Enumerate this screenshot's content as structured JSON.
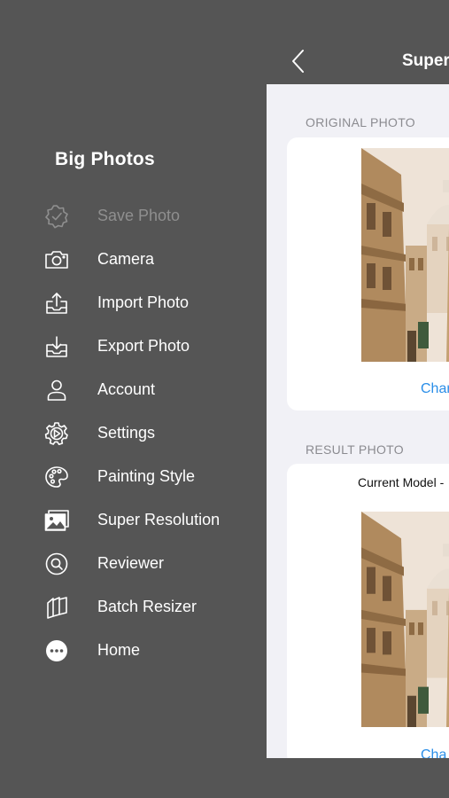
{
  "menu": {
    "title": "Big Photos",
    "items": [
      {
        "label": "Save Photo",
        "icon": "save-check-icon",
        "enabled": false
      },
      {
        "label": "Camera",
        "icon": "camera-icon",
        "enabled": true
      },
      {
        "label": "Import Photo",
        "icon": "import-tray-icon",
        "enabled": true
      },
      {
        "label": "Export Photo",
        "icon": "export-tray-icon",
        "enabled": true
      },
      {
        "label": "Account",
        "icon": "person-icon",
        "enabled": true
      },
      {
        "label": "Settings",
        "icon": "gear-icon",
        "enabled": true
      },
      {
        "label": "Painting Style",
        "icon": "palette-icon",
        "enabled": true
      },
      {
        "label": "Super Resolution",
        "icon": "photos-icon",
        "enabled": true
      },
      {
        "label": "Reviewer",
        "icon": "magnifier-icon",
        "enabled": true
      },
      {
        "label": "Batch Resizer",
        "icon": "stack-icon",
        "enabled": true
      },
      {
        "label": "Home",
        "icon": "ellipsis-circle-icon",
        "enabled": true
      }
    ]
  },
  "nav": {
    "title": "Super",
    "back_icon": "chevron-left-icon"
  },
  "original": {
    "section_label": "ORIGINAL PHOTO",
    "change_label": "Char"
  },
  "result": {
    "section_label": "RESULT PHOTO",
    "model_text": "Current Model -",
    "change_label": "Cha"
  },
  "colors": {
    "menu_background": "#555555",
    "panel_background": "#f1f1f6",
    "link": "#2a8ee8"
  }
}
